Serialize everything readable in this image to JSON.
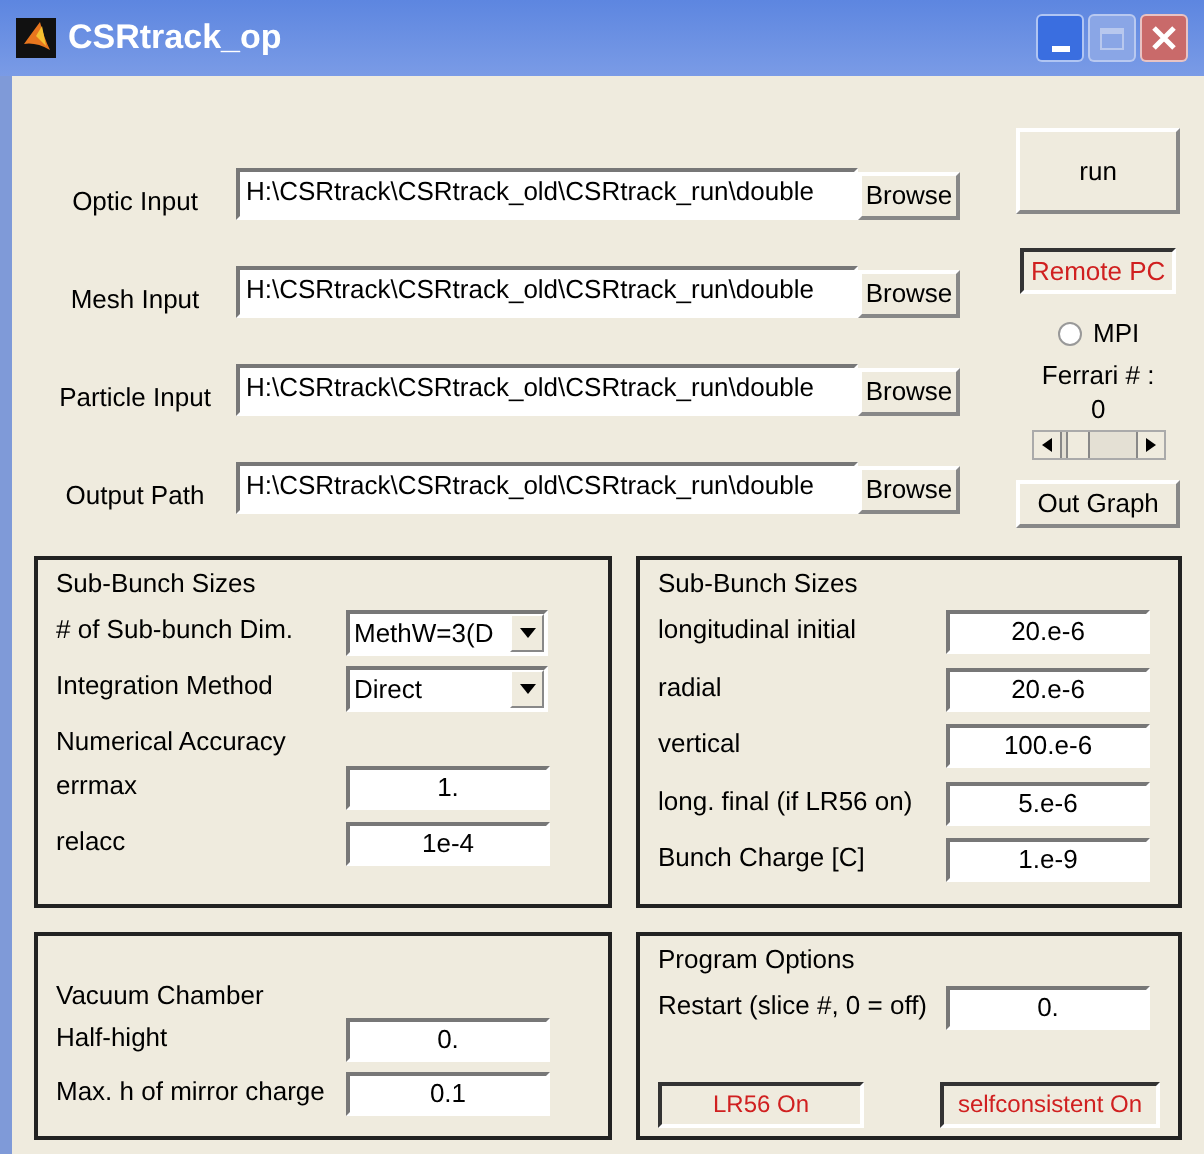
{
  "window": {
    "title": "CSRtrack_op"
  },
  "file_inputs": [
    {
      "label": "Optic Input",
      "value": "H:\\CSRtrack\\CSRtrack_old\\CSRtrack_run\\double",
      "button": "Browse"
    },
    {
      "label": "Mesh Input",
      "value": "H:\\CSRtrack\\CSRtrack_old\\CSRtrack_run\\double",
      "button": "Browse"
    },
    {
      "label": "Particle Input",
      "value": "H:\\CSRtrack\\CSRtrack_old\\CSRtrack_run\\double",
      "button": "Browse"
    },
    {
      "label": "Output Path",
      "value": "H:\\CSRtrack\\CSRtrack_old\\CSRtrack_run\\double",
      "button": "Browse"
    }
  ],
  "run_button": "run",
  "remote_pc": {
    "label": "Remote PC",
    "on": true
  },
  "mpi": {
    "label": "MPI",
    "selected": false
  },
  "ferrari": {
    "label": "Ferrari # :",
    "value": "0"
  },
  "out_graph_button": "Out Graph",
  "panel_rows": [
    [
      {
        "title": "Sub-Bunch Sizes",
        "rows": [
          {
            "kind": "dropdown",
            "label": "# of Sub-bunch Dim.",
            "value": "MethW=3(D"
          },
          {
            "kind": "dropdown",
            "label": "Integration Method",
            "value": "Direct"
          },
          {
            "kind": "heading",
            "label": "Numerical Accuracy"
          },
          {
            "kind": "field",
            "label": "errmax",
            "value": "1."
          },
          {
            "kind": "field",
            "label": "relacc",
            "value": "1e-4"
          }
        ]
      },
      {
        "title": "Sub-Bunch Sizes",
        "rows": [
          {
            "kind": "field",
            "label": "longitudinal initial",
            "value": "20.e-6"
          },
          {
            "kind": "field",
            "label": "radial",
            "value": "20.e-6"
          },
          {
            "kind": "field",
            "label": "vertical",
            "value": "100.e-6"
          },
          {
            "kind": "field",
            "label": "long. final (if LR56 on)",
            "value": "5.e-6"
          },
          {
            "kind": "field",
            "label": "Bunch Charge [C]",
            "value": "1.e-9"
          }
        ]
      }
    ],
    [
      {
        "rows": [
          {
            "kind": "heading",
            "label": "Vacuum Chamber"
          },
          {
            "kind": "field",
            "label": "Half-hight",
            "value": "0."
          },
          {
            "kind": "field",
            "label": "Max. h of mirror charge",
            "value": "0.1"
          }
        ]
      },
      {
        "title": "Program Options",
        "rows": [
          {
            "kind": "field",
            "label": "Restart (slice #, 0 = off)",
            "value": "0."
          },
          {
            "kind": "toggles",
            "items": [
              {
                "label": "LR56 On",
                "on": true
              },
              {
                "label": "selfconsistent On",
                "on": true
              }
            ]
          }
        ]
      }
    ]
  ]
}
